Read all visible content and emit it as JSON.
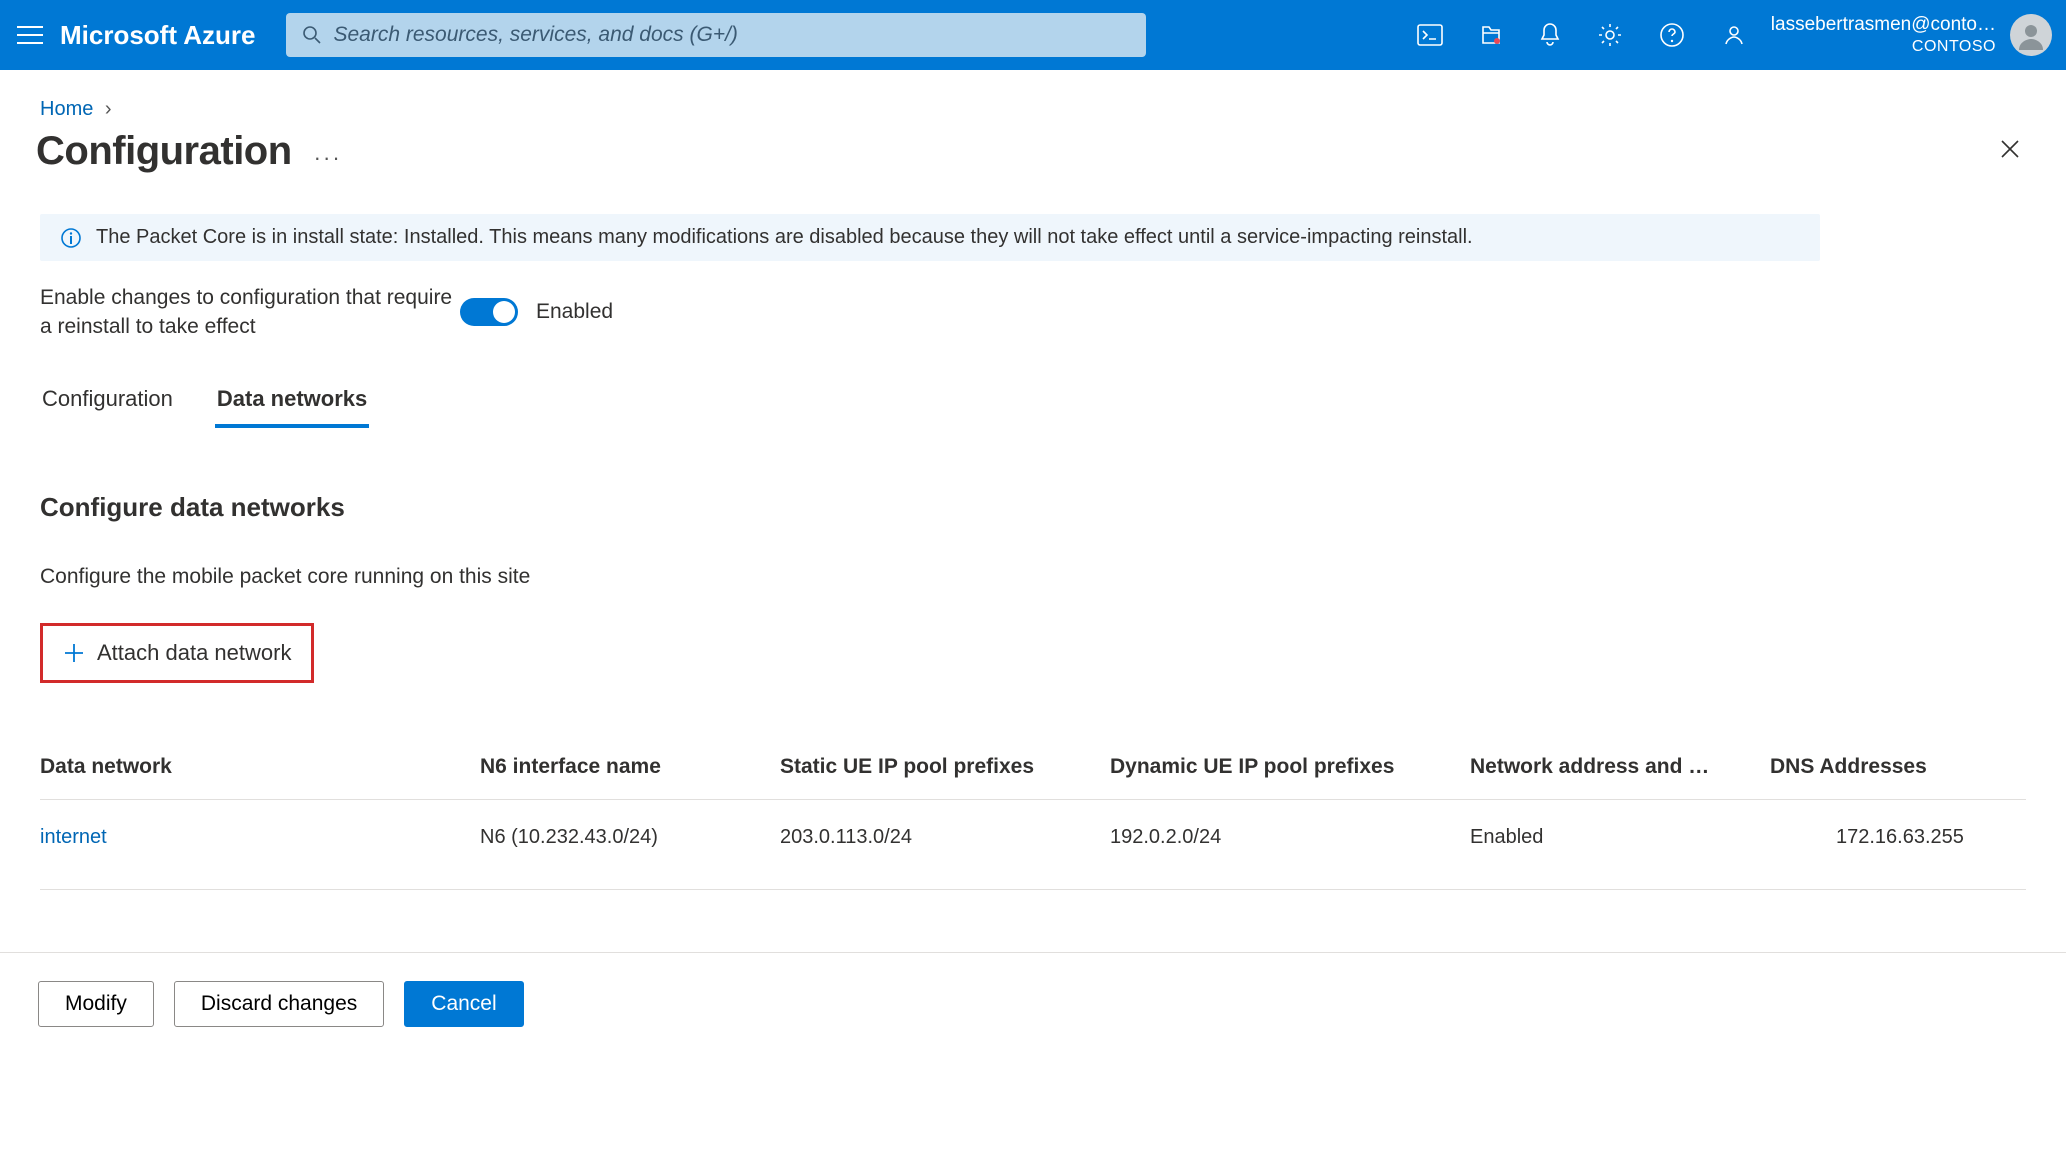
{
  "header": {
    "logo": "Microsoft Azure",
    "search_placeholder": "Search resources, services, and docs (G+/)",
    "user_email": "lassebertrasmen@conto…",
    "user_org": "CONTOSO"
  },
  "breadcrumb": {
    "home": "Home"
  },
  "page_title": "Configuration",
  "info_bar": "The Packet Core is in install state: Installed. This means many modifications are disabled because they will not take effect until a service-impacting reinstall.",
  "toggle": {
    "label": "Enable changes to configuration that require a reinstall to take effect",
    "state": "Enabled"
  },
  "tabs": {
    "configuration": "Configuration",
    "data_networks": "Data networks",
    "active": "data_networks"
  },
  "section": {
    "title": "Configure data networks",
    "desc": "Configure the mobile packet core running on this site",
    "attach_btn": "Attach data network"
  },
  "table": {
    "columns": [
      "Data network",
      "N6 interface name",
      "Static UE IP pool prefixes",
      "Dynamic UE IP pool prefixes",
      "Network address and …",
      "DNS Addresses"
    ],
    "rows": [
      {
        "data_network": "internet",
        "n6": "N6 (10.232.43.0/24)",
        "static_ue": "203.0.113.0/24",
        "dynamic_ue": "192.0.2.0/24",
        "network_addr": "Enabled",
        "dns": "172.16.63.255"
      }
    ]
  },
  "footer": {
    "modify": "Modify",
    "discard": "Discard changes",
    "cancel": "Cancel"
  }
}
